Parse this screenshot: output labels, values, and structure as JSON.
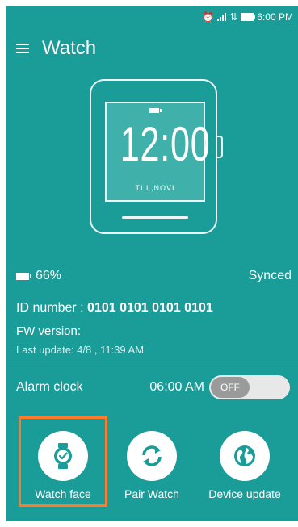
{
  "statusbar": {
    "time": "6:00 PM",
    "icons": [
      "alarm-icon",
      "signal-icon",
      "data-transfer-icon",
      "battery-icon"
    ]
  },
  "appbar": {
    "title": "Watch",
    "menu_icon": "hamburger-menu-icon"
  },
  "watch": {
    "time": "12:00",
    "date": "TI L,NOVI"
  },
  "info": {
    "battery_percent": "66%",
    "sync_status": "Synced",
    "id_label": "ID number :",
    "id_value": "0101 0101 0101 0101",
    "fw_label": "FW version:",
    "last_update": "Last update: 4/8 , 11:39 AM"
  },
  "alarm": {
    "label": "Alarm clock",
    "time": "06:00 AM",
    "toggle_label": "OFF"
  },
  "actions": [
    {
      "label": "Watch face",
      "icon": "watch-icon",
      "selected": true
    },
    {
      "label": "Pair Watch",
      "icon": "sync-icon",
      "selected": false
    },
    {
      "label": "Device update",
      "icon": "globe-icon",
      "selected": false
    }
  ],
  "colors": {
    "background": "#1a9c98",
    "icon": "#1a9c98",
    "selection_border": "#ff7a2a",
    "toggle_off": "#9a9a9a"
  }
}
